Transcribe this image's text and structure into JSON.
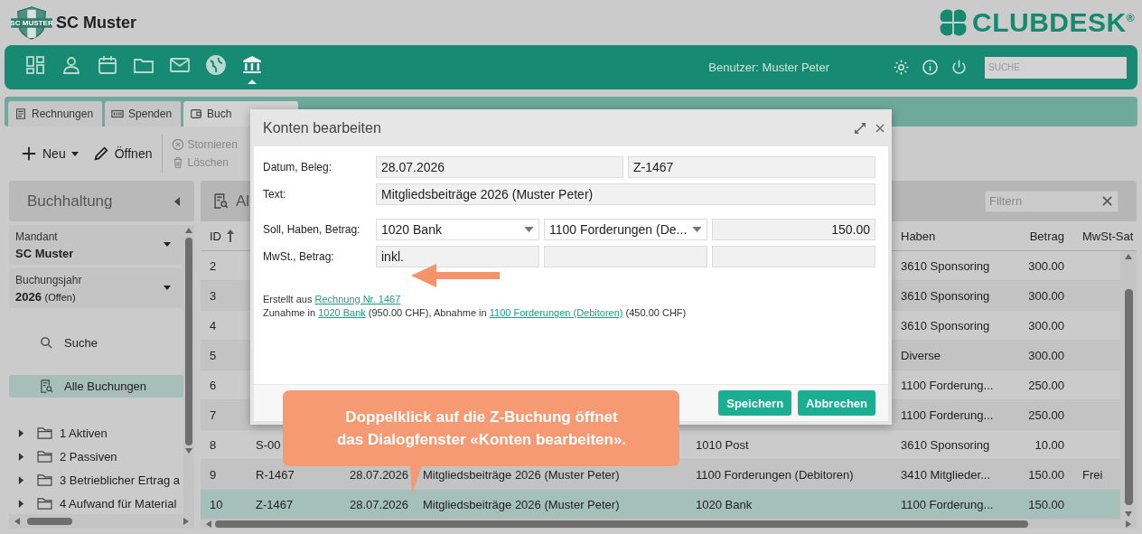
{
  "header": {
    "logo_text": "SC MUSTER",
    "club_name": "SC Muster",
    "brand": "CLUBDESK$^{®}$"
  },
  "nav": {
    "items": [
      {
        "selected": false
      },
      {
        "selected": false
      },
      {
        "selected": false
      },
      {
        "selected": false
      },
      {
        "selected": false
      },
      {
        "selected": false
      },
      {
        "selected": true
      }
    ],
    "user": "Benutzer: Muster Peter",
    "search": {
      "placeholder": "SUCHE"
    }
  },
  "tabs": [
    {
      "label": "Rechnungen",
      "selected": false
    },
    {
      "label": "Spenden",
      "selected": false
    },
    {
      "label": "Buch",
      "selected": true
    }
  ],
  "toolbar": [
    {
      "label": "Neu",
      "kind": "large",
      "disabled": false
    },
    {
      "label": "Öffnen",
      "kind": "large",
      "disabled": false
    },
    {
      "label": "Stornieren",
      "kind": "small",
      "disabled": true
    },
    {
      "label": "Löschen",
      "kind": "small",
      "disabled": true
    }
  ],
  "sidebar": {
    "title": "Buchhaltung",
    "mandant": {
      "label": "Mandant",
      "value": "SC Muster"
    },
    "year": {
      "label": "Buchungsjahr",
      "value": "2026",
      "status": "(Offen)"
    },
    "items": [
      {
        "label": "Suche",
        "selected": false
      },
      {
        "label": "Alle Buchungen",
        "selected": true
      }
    ],
    "tree": [
      {
        "label": "1 Aktiven",
        "expanded": false
      },
      {
        "label": "2 Passiven",
        "expanded": false
      },
      {
        "label": "3 Betrieblicher Ertrag a",
        "expanded": false
      },
      {
        "label": "4 Aufwand für Material",
        "expanded": false
      }
    ]
  },
  "main": {
    "title": "Al",
    "filter": {
      "placeholder": "Filtern"
    },
    "header": {
      "id": "ID",
      "haben": "Haben",
      "betrag": "Betrag",
      "mwst": "MwSt-Sat"
    },
    "rows": [
      {
        "id": "2",
        "haben": "3610 Sponsoring",
        "betrag": "300.00",
        "selected": false
      },
      {
        "id": "3",
        "haben": "3610 Sponsoring",
        "betrag": "300.00",
        "selected": false
      },
      {
        "id": "4",
        "haben": "3610 Sponsoring",
        "betrag": "300.00",
        "selected": false
      },
      {
        "id": "5",
        "haben": "Diverse",
        "betrag": "300.00",
        "selected": false
      },
      {
        "id": "6",
        "haben": "1100 Forderung...",
        "betrag": "250.00",
        "selected": false
      },
      {
        "id": "7",
        "haben": "1100 Forderung...",
        "betrag": "250.00",
        "selected": false
      },
      {
        "id": "8",
        "beleg": "S-00",
        "soll": "1010 Post",
        "haben": "3610 Sponsoring",
        "betrag": "10.00",
        "selected": false
      },
      {
        "id": "9",
        "beleg": "R-1467",
        "datum": "28.07.2026",
        "text": "Mitgliedsbeiträge 2026 (Muster Peter)",
        "soll": "1100 Forderungen (Debitoren)",
        "haben": "3410 Mitglieder...",
        "betrag": "150.00",
        "mwst": "Frei",
        "selected": false
      },
      {
        "id": "10",
        "beleg": "Z-1467",
        "datum": "28.07.2026",
        "text": "Mitgliedsbeiträge 2026 (Muster Peter)",
        "soll": "1020 Bank",
        "haben": "1100 Forderung...",
        "betrag": "150.00",
        "selected": true
      }
    ]
  },
  "dialog": {
    "title": "Konten bearbeiten",
    "rows": [
      {
        "label": "Datum, Beleg:",
        "fields": [
          {
            "kind": "text",
            "value": "28.07.2026"
          },
          {
            "kind": "text",
            "value": "Z-1467"
          }
        ]
      },
      {
        "label": "Text:",
        "fields": [
          {
            "kind": "text",
            "value": "Mitgliedsbeiträge 2026 (Muster Peter)"
          }
        ]
      },
      {
        "label": "Soll, Haben, Betrag:",
        "fields": [
          {
            "kind": "select",
            "value": "1020 Bank"
          },
          {
            "kind": "select",
            "value": "1100 Forderungen (De..."
          },
          {
            "kind": "number",
            "value": "150.00"
          }
        ]
      },
      {
        "label": "MwSt., Betrag:",
        "fields": [
          {
            "kind": "text",
            "value": "inkl."
          },
          {
            "kind": "text"
          },
          {
            "kind": "number"
          }
        ]
      }
    ],
    "info": [
      [
        {
          "kind": "text",
          "text": "Erstellt aus "
        },
        {
          "kind": "link",
          "text": "Rechnung Nr. 1467"
        }
      ],
      [
        {
          "kind": "text",
          "text": "Zunahme in "
        },
        {
          "kind": "link",
          "text": "1020 Bank"
        },
        {
          "kind": "text",
          "text": " (950.00 CHF), Abnahme in "
        },
        {
          "kind": "link",
          "text": "1100 Forderungen (Debitoren)"
        },
        {
          "kind": "text",
          "text": " (450.00 CHF)"
        }
      ]
    ],
    "buttons": [
      "Speichern",
      "Abbrechen"
    ]
  },
  "callout": "Doppelklick auf die Z-Buchung öffnet\ndas Dialogfenster «Konten bearbeiten»."
}
